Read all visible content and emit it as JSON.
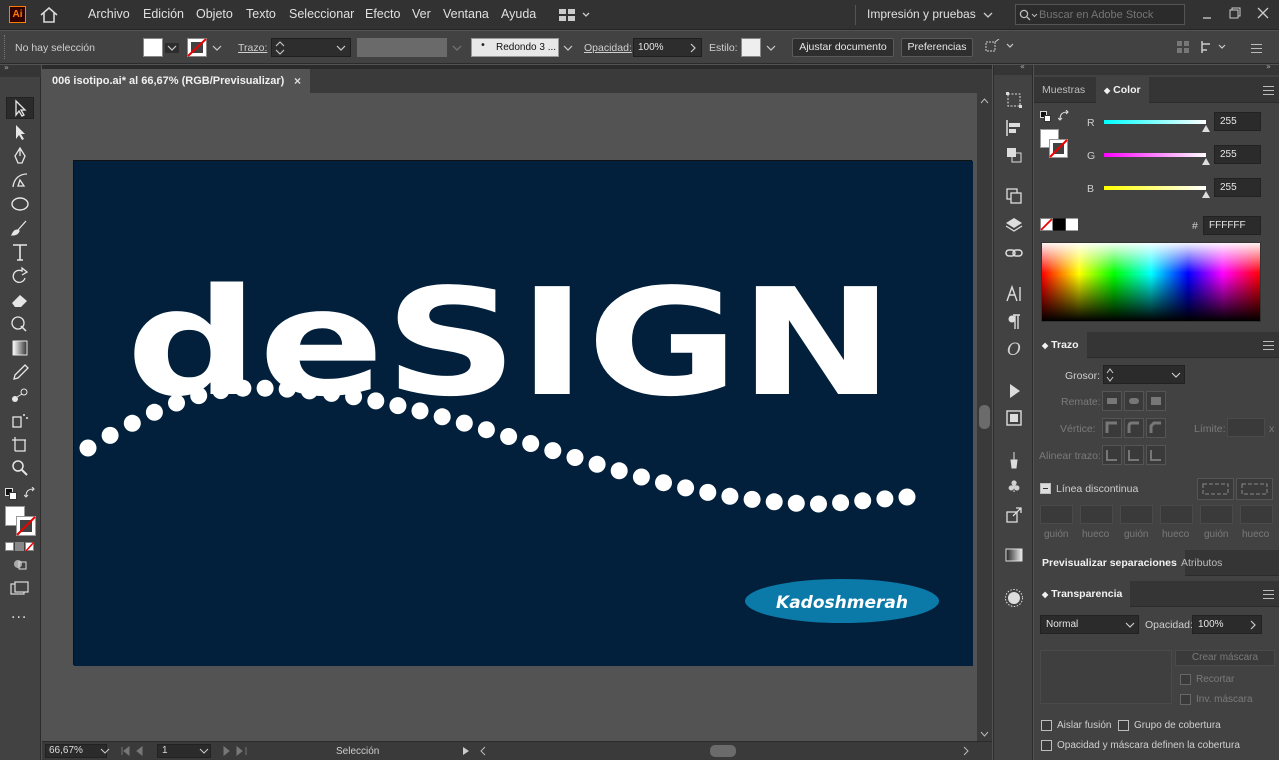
{
  "app": {
    "logo": "Ai"
  },
  "menu": [
    "Archivo",
    "Edición",
    "Objeto",
    "Texto",
    "Seleccionar",
    "Efecto",
    "Ver",
    "Ventana",
    "Ayuda"
  ],
  "workspace": "Impresión y pruebas",
  "search_placeholder": "Buscar en Adobe Stock",
  "control": {
    "selection": "No hay selección",
    "stroke_label": "Trazo:",
    "brush": "Redondo 3 ...",
    "opacity_label": "Opacidad:",
    "opacity_value": "100%",
    "style_label": "Estilo:",
    "adjust_button": "Ajustar documento",
    "prefs_button": "Preferencias"
  },
  "document": {
    "tab_title": "006 isotipo.ai* al 66,67% (RGB/Previsualizar)",
    "close": "×",
    "artwork_text": "deSIGN",
    "signature": "Kadoshmerah",
    "bg_color": "#02203b",
    "signature_color": "#0b7aa8"
  },
  "status": {
    "zoom": "66,67%",
    "page": "1",
    "tool": "Selección"
  },
  "color_panel": {
    "tabs": [
      "Muestras",
      "Color"
    ],
    "r_label": "R",
    "r_value": "255",
    "g_label": "G",
    "g_value": "255",
    "b_label": "B",
    "b_value": "255",
    "hash": "#",
    "hex": "FFFFFF"
  },
  "stroke_panel": {
    "title": "Trazo",
    "weight_label": "Grosor:",
    "cap_label": "Remate:",
    "corner_label": "Vértice:",
    "limit_label": "Límite:",
    "limit_x": "x",
    "align_label": "Alinear trazo:",
    "dashed_label": "Línea discontinua",
    "dash_labels": [
      "guión",
      "hueco",
      "guión",
      "hueco",
      "guión",
      "hueco"
    ]
  },
  "sep_tabs": [
    "Previsualizar separaciones",
    "Atributos"
  ],
  "transparency": {
    "title": "Transparencia",
    "mode": "Normal",
    "opacity_label": "Opacidad:",
    "opacity_value": "100%",
    "create_mask": "Crear máscara",
    "clip": "Recortar",
    "invert": "Inv. máscara",
    "isolate": "Aislar fusión",
    "knockout": "Grupo de cobertura",
    "opacity_mask": "Opacidad y máscara definen la cobertura"
  }
}
